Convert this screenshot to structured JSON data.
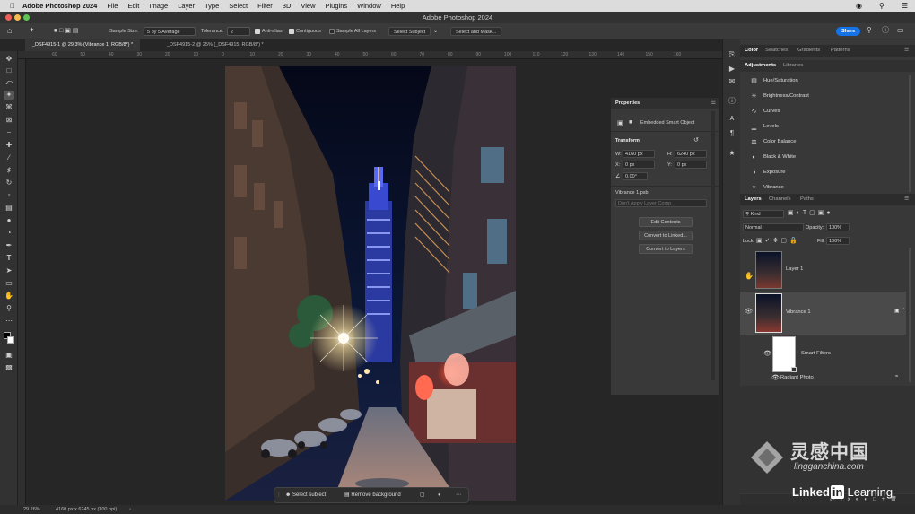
{
  "menubar": {
    "app": "Adobe Photoshop 2024",
    "items": [
      "File",
      "Edit",
      "Image",
      "Layer",
      "Type",
      "Select",
      "Filter",
      "3D",
      "View",
      "Plugins",
      "Window",
      "Help"
    ]
  },
  "window_title": "Adobe Photoshop 2024",
  "options": {
    "sample_size_label": "Sample Size:",
    "sample_size_value": "5 by 5 Average",
    "tolerance_label": "Tolerance:",
    "tolerance_value": "2",
    "anti_alias": "Anti-alias",
    "contiguous": "Contiguous",
    "sample_all_layers": "Sample All Layers",
    "select_subject": "Select Subject",
    "select_and_mask": "Select and Mask...",
    "share": "Share"
  },
  "tabs": [
    {
      "label": "_DSF4915-1 @ 29.3% (Vibrance 1, RGB/8*) *"
    },
    {
      "label": "_DSF4915-2 @ 25% (_DSF4915, RGB/8*) *"
    }
  ],
  "ruler_ticks": [
    "60",
    "50",
    "40",
    "30",
    "20",
    "10",
    "0",
    "10",
    "20",
    "30",
    "40",
    "50",
    "60",
    "70",
    "80",
    "90",
    "100",
    "110",
    "120",
    "130",
    "140",
    "150",
    "160"
  ],
  "status": {
    "zoom": "29.26%",
    "doc_info": "4160 px x 6245 px (300 ppi)"
  },
  "context_bar": {
    "select_subject": "Select subject",
    "remove_background": "Remove background"
  },
  "properties": {
    "title": "Properties",
    "type": "Embedded Smart Object",
    "transform": "Transform",
    "w_label": "W:",
    "w_value": "4160 px",
    "h_label": "H:",
    "h_value": "6240 px",
    "x_label": "X:",
    "x_value": "0 px",
    "y_label": "Y:",
    "y_value": "0 px",
    "angle_value": "0.00°",
    "file": "Vibrance 1.psb",
    "layer_comp": "Don't Apply Layer Comp",
    "edit_contents": "Edit Contents",
    "convert_linked": "Convert to Linked...",
    "convert_layers": "Convert to Layers"
  },
  "top_panel": {
    "tabs": [
      "Color",
      "Swatches",
      "Gradients",
      "Patterns"
    ],
    "subtabs": [
      "Adjustments",
      "Libraries"
    ],
    "adjustments": [
      "Hue/Saturation",
      "Brightness/Contrast",
      "Curves",
      "Levels",
      "Color Balance",
      "Black & White",
      "Exposure",
      "Vibrance"
    ]
  },
  "layers_panel": {
    "tabs": [
      "Layers",
      "Channels",
      "Paths"
    ],
    "kind": "Kind",
    "blend_mode": "Normal",
    "opacity_label": "Opacity:",
    "opacity_value": "100%",
    "lock_label": "Lock:",
    "fill_label": "Fill:",
    "fill_value": "100%",
    "layers": [
      {
        "name": "Layer 1"
      },
      {
        "name": "Vibrance 1"
      },
      {
        "name": "Smart Filters"
      },
      {
        "name": "Radiant Photo"
      }
    ]
  },
  "watermark": {
    "cn": "灵感中国",
    "url": "lingganchina.com",
    "brand_a": "Linked",
    "brand_in": "in",
    "brand_b": "Learning"
  },
  "colors": {
    "accent": "#1473e6",
    "panel": "#383838",
    "canvas": "#262626"
  }
}
